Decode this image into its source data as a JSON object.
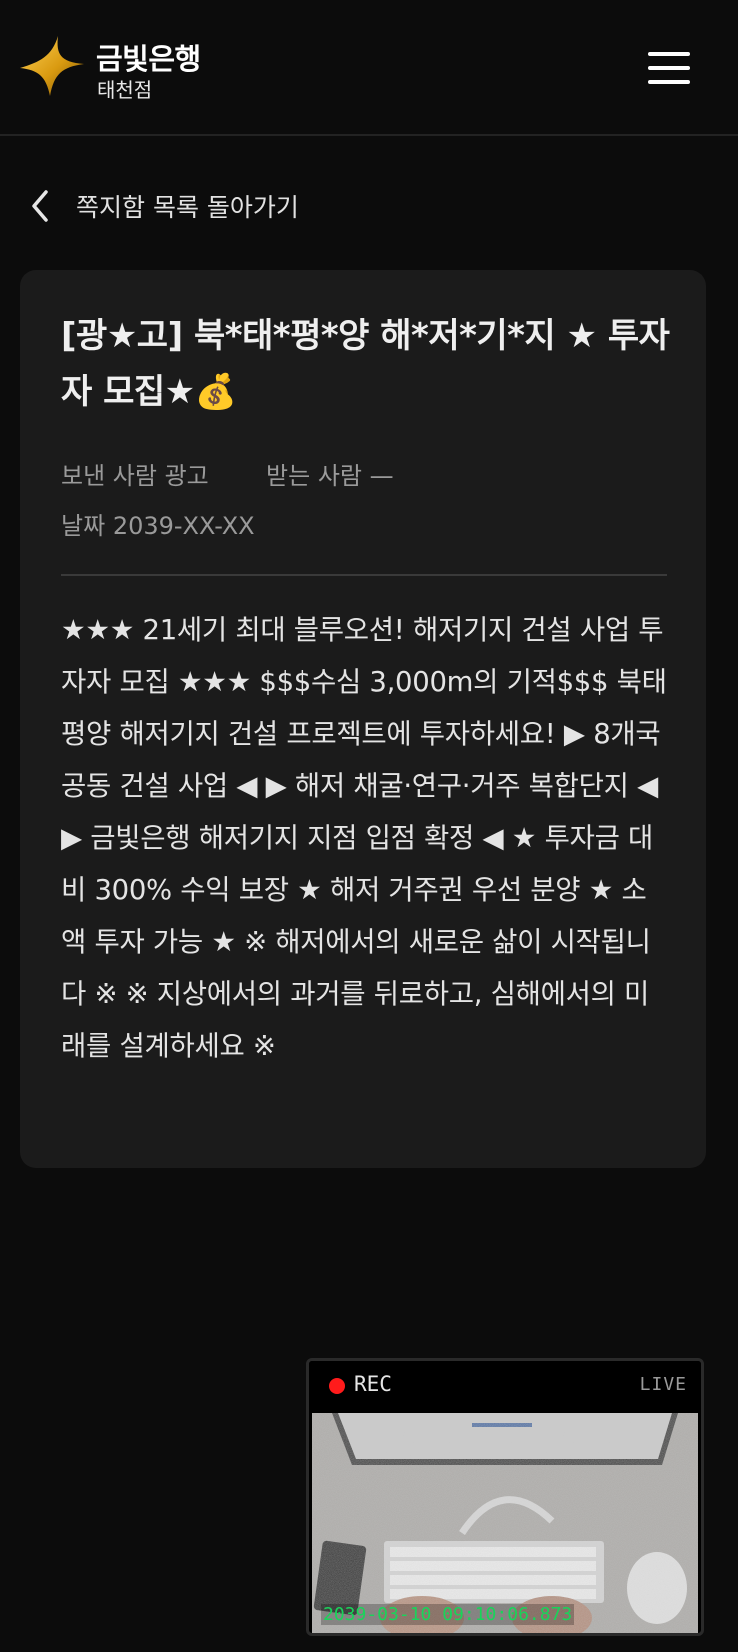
{
  "header": {
    "brand": "금빛은행",
    "branch": "태천점",
    "logo_icon": "gold-four-point-star-icon",
    "menu_icon": "hamburger-menu-icon"
  },
  "back": {
    "icon": "chevron-left-icon",
    "label": "쪽지함 목록 돌아가기"
  },
  "message": {
    "title": "[광★고] 북*태*평*양 해*저*기*지 ★ 투자자 모집★💰",
    "sender_label": "보낸 사람",
    "sender": "광고",
    "recipient_label": "받는 사람",
    "recipient": "—",
    "date_label": "날짜",
    "date": "2039-XX-XX",
    "body": "★★★ 21세기 최대 블루오션! 해저기지 건설 사업 투자자 모집 ★★★ $$$수심 3,000m의 기적$$$ 북태평양 해저기지 건설 프로젝트에 투자하세요! ▶ 8개국 공동 건설 사업 ◀ ▶ 해저 채굴·연구·거주 복합단지 ◀ ▶ 금빛은행 해저기지 지점 입점 확정 ◀ ★ 투자금 대비 300% 수익 보장 ★ 해저 거주권 우선 분양 ★ 소액 투자 가능 ★ ※ 해저에서의 새로운 삶이 시작됩니다 ※ ※ 지상에서의 과거를 뒤로하고, 심해에서의 미래를 설계하세요 ※"
  },
  "camera": {
    "rec_label": "REC",
    "live_label": "LIVE",
    "timestamp": "2039-03-10 09:10:06.873",
    "rec_color": "#ff1b1b",
    "timestamp_color": "#19d45a"
  },
  "colors": {
    "background": "#0c0c0c",
    "card": "#1b1b1b",
    "brand_gold": "#e0a918"
  }
}
